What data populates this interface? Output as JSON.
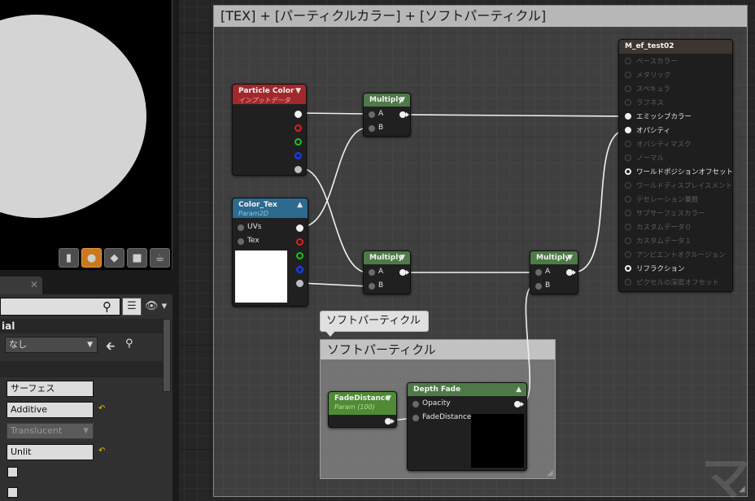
{
  "graph": {
    "main_comment": "[TEX] + [パーティクルカラー] + [ソフトパーティクル]",
    "soft_bubble": "ソフトパーティクル",
    "soft_comment": "ソフトパーティクル"
  },
  "nodes": {
    "particle_color": {
      "title": "Particle Color",
      "subtitle": "インプットデータ",
      "color": "#a2282c"
    },
    "color_tex": {
      "title": "Color_Tex",
      "subtitle": "Param2D",
      "color": "#2c6a8e",
      "pins": [
        "UVs",
        "Tex"
      ]
    },
    "multiply_top": {
      "title": "Multiply",
      "pins": [
        "A",
        "B"
      ]
    },
    "multiply_mid": {
      "title": "Multiply",
      "pins": [
        "A",
        "B"
      ]
    },
    "multiply_right": {
      "title": "Multiply",
      "pins": [
        "A",
        "B"
      ]
    },
    "fade_distance": {
      "title": "FadeDistance",
      "subtitle": "Param (100)"
    },
    "depth_fade": {
      "title": "Depth Fade",
      "pins": [
        "Opacity",
        "FadeDistance"
      ]
    },
    "material": {
      "title": "M_ef_test02",
      "pins": [
        {
          "label": "ベースカラー",
          "active": false
        },
        {
          "label": "メタリック",
          "active": false
        },
        {
          "label": "スペキュラ",
          "active": false
        },
        {
          "label": "ラフネス",
          "active": false
        },
        {
          "label": "エミッシブカラー",
          "active": true
        },
        {
          "label": "オパシティ",
          "active": true
        },
        {
          "label": "オパシティマスク",
          "active": false
        },
        {
          "label": "ノーマル",
          "active": false
        },
        {
          "label": "ワールドポジションオフセット",
          "active": true
        },
        {
          "label": "ワールドディスプレイスメント",
          "active": false
        },
        {
          "label": "テセレーション乗数",
          "active": false
        },
        {
          "label": "サブサーフェスカラー",
          "active": false
        },
        {
          "label": "カスタムデータ０",
          "active": false
        },
        {
          "label": "カスタムデータ１",
          "active": false
        },
        {
          "label": "アンビエントオクルージョン",
          "active": false
        },
        {
          "label": "リフラクション",
          "active": true
        },
        {
          "label": "ピクセルの深度オフセット",
          "active": false
        }
      ]
    }
  },
  "details": {
    "section_title": "ial",
    "parent_value": "なし",
    "material_domain": "サーフェス",
    "blend_mode": "Additive",
    "translucency": "Translucent",
    "shading_model": "Unlit"
  },
  "viewport_buttons": [
    "cylinder-icon",
    "sphere-icon",
    "plane-icon",
    "cube-icon",
    "teapot-icon"
  ],
  "colors": {
    "accent_orange": "#c9781f",
    "reset_yellow": "#e6c400",
    "wire": "#f0f0f0"
  }
}
